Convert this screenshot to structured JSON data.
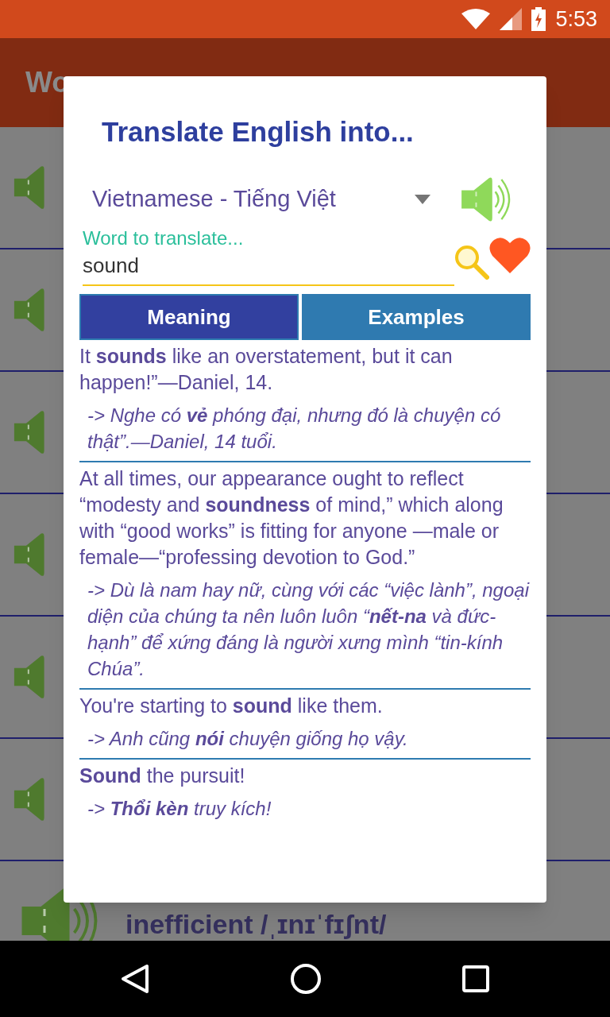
{
  "status_bar": {
    "time": "5:53"
  },
  "app_bar": {
    "title": "Wo"
  },
  "word_rows": [
    {
      "playing": false
    },
    {
      "playing": false
    },
    {
      "playing": false
    },
    {
      "playing": false
    },
    {
      "playing": false
    },
    {
      "playing": false
    },
    {
      "playing": true,
      "word": "inefficient /ˌɪnɪˈfɪʃnt/"
    }
  ],
  "dialog": {
    "title": "Translate English into...",
    "language": "Vietnamese - Tiếng Việt",
    "field": {
      "label": "Word to translate...",
      "value": "sound"
    },
    "favorite": true,
    "tabs": [
      {
        "label": "Meaning",
        "selected": true
      },
      {
        "label": "Examples",
        "selected": false
      }
    ],
    "examples": [
      {
        "english": "It **sounds** like an overstatement, but it can happen!”—Daniel, 14.",
        "translation": "-> Nghe có **vẻ** phóng đại, nhưng đó là chuyện có thật”.—Daniel, 14 tuổi."
      },
      {
        "english": "At all times, our appearance ought to reflect “modesty and **soundness** of mind,” which along with “good works” is fitting for anyone —male or female—“professing devotion to God.”",
        "translation": "-> Dù là nam hay nữ, cùng với các “việc lành”, ngoại diện của chúng ta nên luôn luôn “**nết-na** và đức-hạnh” để xứng đáng là người xưng mình “tin-kính Chúa”."
      },
      {
        "english": "You're starting to **sound** like them.",
        "translation": "-> Anh cũng **nói** chuyện giống họ vậy."
      },
      {
        "english": "**Sound** the pursuit!",
        "translation": "-> **Thổi kèn** truy kích!"
      }
    ]
  }
}
